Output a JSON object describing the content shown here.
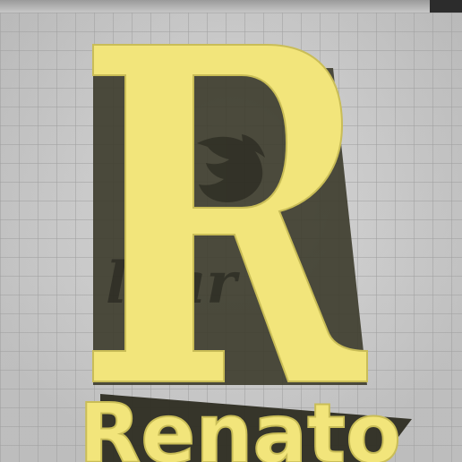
{
  "design": {
    "monogram": "R",
    "name": "Renato",
    "ghost_text": "lnar"
  },
  "colors": {
    "letter_fill": "#f2e57b",
    "letter_outline": "#c9bd57",
    "shadow": "#3f3e2f",
    "grid_bg": "#cfcfcf",
    "grid_line": "#a0a0a0"
  },
  "icons": {
    "emblem": "lion-head-icon"
  }
}
